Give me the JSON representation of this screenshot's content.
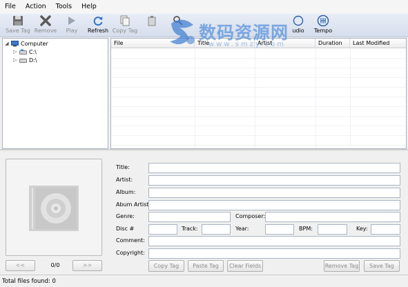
{
  "menu": [
    "File",
    "Action",
    "Tools",
    "Help"
  ],
  "toolbar": {
    "save_tag": "Save Tag",
    "remove": "Remove",
    "play": "Play",
    "refresh": "Refresh",
    "copy_tag": "Copy Tag",
    "audio": "udio",
    "tempo": "Tempo"
  },
  "tree": {
    "root": "Computer",
    "drives": [
      "C:\\",
      "D:\\"
    ]
  },
  "file_list": {
    "columns": [
      "File",
      "Title",
      "Artist",
      "Duration",
      "Last Modified"
    ]
  },
  "watermark": {
    "text": "数码资源网",
    "url": "www.smzy.com"
  },
  "cover": {
    "prev": "<<",
    "next": ">>",
    "count": "0/0"
  },
  "fields": {
    "title": "Title:",
    "artist": "Artist:",
    "album": "Album:",
    "album_artist": "Abum Artist:",
    "genre": "Genre:",
    "composer": "Composer:",
    "disc": "Disc #",
    "track": "Track:",
    "year": "Year:",
    "bpm": "BPM:",
    "key": "Key:",
    "comment": "Comment:",
    "copyright": "Copyright:"
  },
  "buttons": {
    "copy_tag": "Copy Tag",
    "paste_tag": "Paste Tag",
    "clear_fields": "Clear Fields",
    "remove_tag": "Remove Tag",
    "save_tag": "Save Tag"
  },
  "status": "Total files found: 0"
}
